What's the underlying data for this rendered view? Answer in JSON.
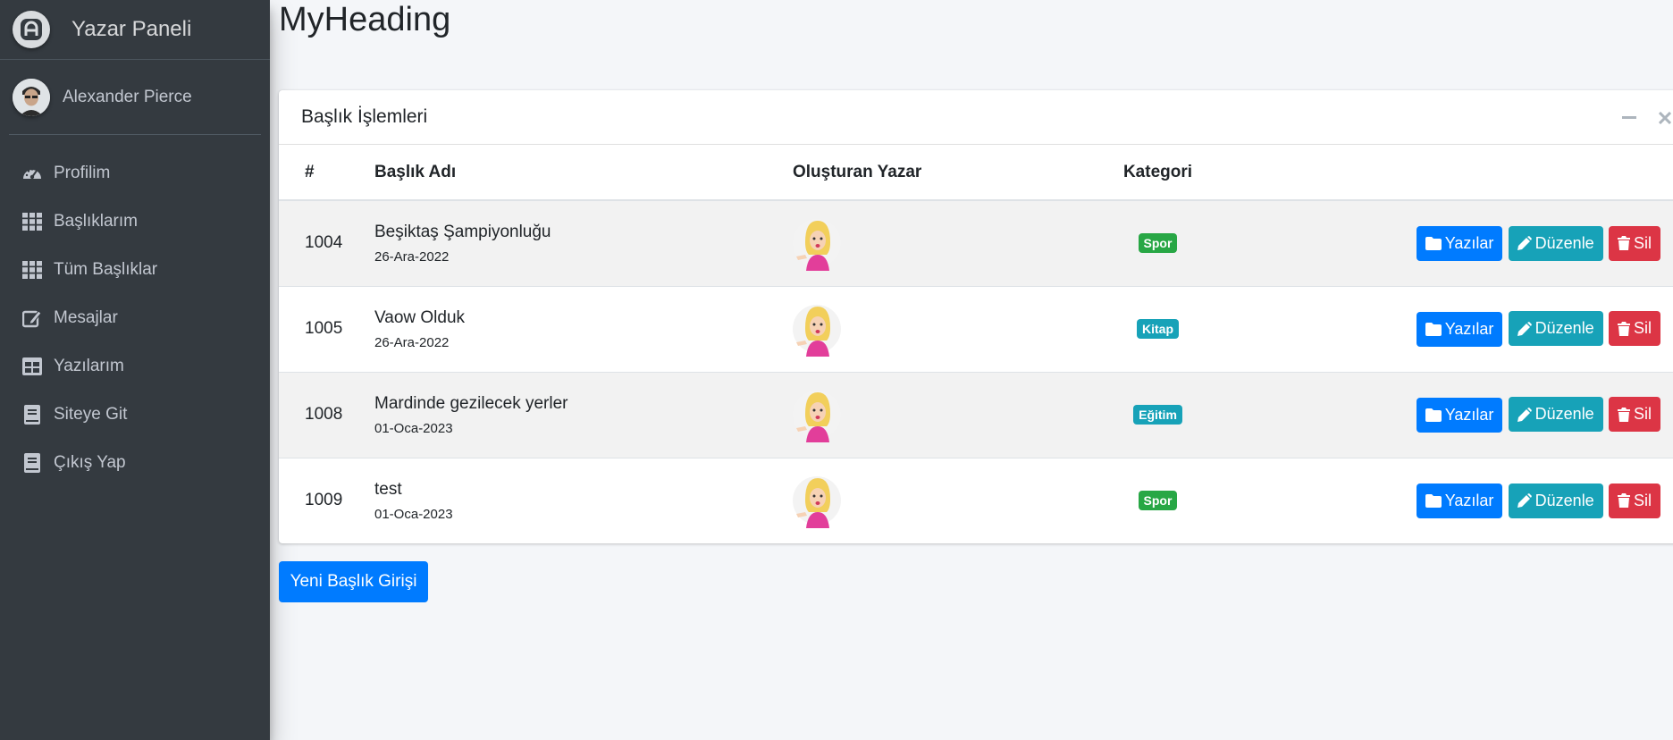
{
  "sidebar": {
    "brand": "Yazar Paneli",
    "user_name": "Alexander Pierce",
    "items": [
      {
        "label": "Profilim",
        "icon": "tachometer-icon"
      },
      {
        "label": "Başlıklarım",
        "icon": "grid-icon"
      },
      {
        "label": "Tüm Başlıklar",
        "icon": "grid-icon"
      },
      {
        "label": "Mesajlar",
        "icon": "edit-icon"
      },
      {
        "label": "Yazılarım",
        "icon": "table-icon"
      },
      {
        "label": "Siteye Git",
        "icon": "book-icon"
      },
      {
        "label": "Çıkış Yap",
        "icon": "book-icon"
      }
    ]
  },
  "page": {
    "title": "MyHeading"
  },
  "card": {
    "title": "Başlık İşlemleri",
    "columns": [
      "#",
      "Başlık Adı",
      "Oluşturan Yazar",
      "Kategori"
    ],
    "rows": [
      {
        "id": "1004",
        "title": "Beşiktaş Şampiyonluğu",
        "date": "26-Ara-2022",
        "category": "Spor",
        "category_color": "#28a745"
      },
      {
        "id": "1005",
        "title": "Vaow Olduk",
        "date": "26-Ara-2022",
        "category": "Kitap",
        "category_color": "#17a2b8"
      },
      {
        "id": "1008",
        "title": "Mardinde gezilecek yerler",
        "date": "01-Oca-2023",
        "category": "Eğitim",
        "category_color": "#17a2b8"
      },
      {
        "id": "1009",
        "title": "test",
        "date": "01-Oca-2023",
        "category": "Spor",
        "category_color": "#28a745"
      }
    ],
    "actions": {
      "posts": "Yazılar",
      "edit": "Düzenle",
      "delete": "Sil"
    }
  },
  "new_button": "Yeni Başlık Girişi",
  "colors": {
    "sidebar_bg": "#343a40",
    "primary": "#007bff",
    "info": "#17a2b8",
    "danger": "#dc3545",
    "success": "#28a745"
  }
}
